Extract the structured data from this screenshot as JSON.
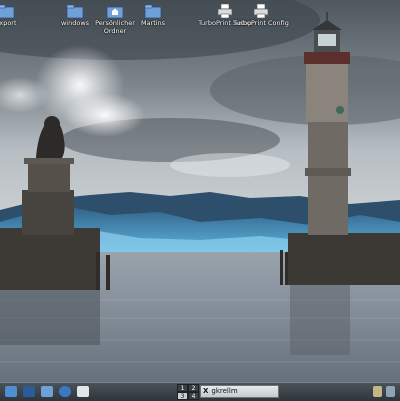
{
  "desktop": {
    "icons": [
      {
        "label": "export"
      },
      {
        "label": "windows"
      },
      {
        "label": "Persönlicher Ordner"
      },
      {
        "label": "Martins"
      },
      {
        "label": "TurboPrint Setup"
      },
      {
        "label": "TurboPrint Config"
      }
    ]
  },
  "taskbar": {
    "pager": [
      "1",
      "2",
      "3",
      "4"
    ],
    "active_workspace": "3",
    "task": {
      "close_glyph": "X",
      "title": "gkrellm"
    }
  },
  "colors": {
    "sky": "#8e98a0",
    "water": "#8793a0",
    "mountains": "#4f9cc4",
    "stone": "#4e4a45",
    "taskbar": "#3a4046"
  }
}
